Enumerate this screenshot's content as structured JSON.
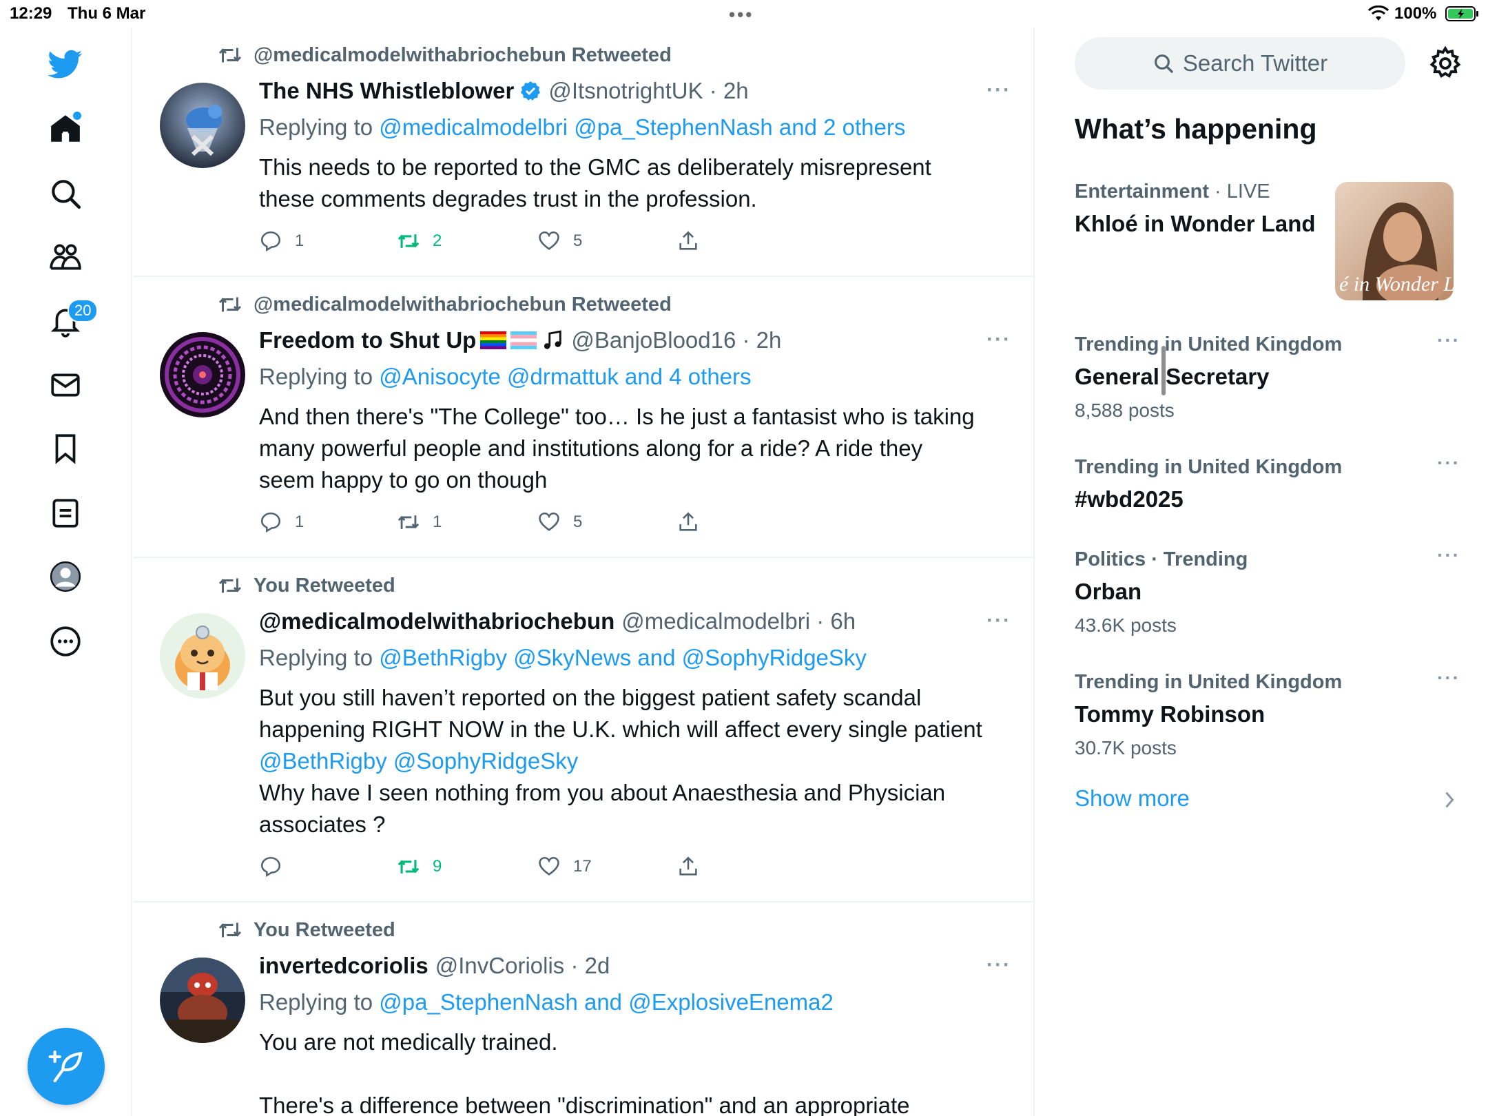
{
  "status_bar": {
    "time": "12:29",
    "date": "Thu 6 Mar",
    "battery": "100%"
  },
  "nav": {
    "notifications_badge": "20"
  },
  "tweets": [
    {
      "context": "@medicalmodelwithabriochebun Retweeted",
      "name": "The NHS Whistleblower",
      "handle": "@ItsnotrightUK · 2h",
      "replying_prefix": "Replying to ",
      "replying_to": "@medicalmodelbri @pa_StephenNash and 2 others",
      "lines": [
        "This needs to be reported to the GMC as deliberately misrepresent",
        "these comments degrades trust in the profession."
      ],
      "replies": "1",
      "retweets": "2",
      "likes": "5"
    },
    {
      "context": "@medicalmodelwithabriochebun Retweeted",
      "name": "Freedom to Shut Up",
      "handle": "@BanjoBlood16 · 2h",
      "replying_prefix": "Replying to ",
      "replying_to": "@Anisocyte @drmattuk and 4 others",
      "lines": [
        "And then there's \"The College\" too… Is he just a fantasist who is taking",
        "many powerful people and institutions along for a ride? A ride they",
        "seem happy to go on though"
      ],
      "replies": "1",
      "retweets": "1",
      "likes": "5"
    },
    {
      "context": "You Retweeted",
      "name": "@medicalmodelwithabriochebun",
      "handle": "@medicalmodelbri · 6h",
      "replying_prefix": "Replying to ",
      "replying_to": "@BethRigby @SkyNews and @SophyRidgeSky",
      "lines": [
        "But you still haven’t reported on the biggest patient safety scandal",
        "happening RIGHT NOW in the U.K. which will affect every single patient"
      ],
      "mentions": "@BethRigby @SophyRidgeSky",
      "lines2": [
        "Why have I seen nothing from you about Anaesthesia and Physician",
        "associates ?"
      ],
      "retweets": "9",
      "likes": "17"
    },
    {
      "context": "You Retweeted",
      "name": "invertedcoriolis",
      "handle": "@InvCoriolis · 2d",
      "replying_prefix": "Replying to ",
      "replying_to": "@pa_StephenNash and @ExplosiveEnema2",
      "lines": [
        "You are not medically trained.",
        "",
        "There's a difference between \"discrimination\" and an appropriate"
      ]
    }
  ],
  "sidebar": {
    "search_placeholder": "Search Twitter",
    "title": "What’s happening",
    "trends": [
      {
        "category": "Entertainment",
        "suffix": " · LIVE",
        "title": "Khloé in Wonder Land",
        "image_caption": "é in Wonder L"
      },
      {
        "category": "Trending in United Kingdom",
        "suffix": "",
        "title": "General Secretary",
        "count": "8,588 posts"
      },
      {
        "category": "Trending in United Kingdom",
        "suffix": "",
        "title": "#wbd2025"
      },
      {
        "category": "Politics · Trending",
        "suffix": "",
        "title": "Orban",
        "count": "43.6K posts"
      },
      {
        "category": "Trending in United Kingdom",
        "suffix": "",
        "title": "Tommy Robinson",
        "count": "30.7K posts"
      }
    ],
    "show_more": "Show more"
  },
  "colors": {
    "accent": "#1d9bf0",
    "retweet_green": "#00ba7c",
    "secondary_text": "#536471"
  }
}
